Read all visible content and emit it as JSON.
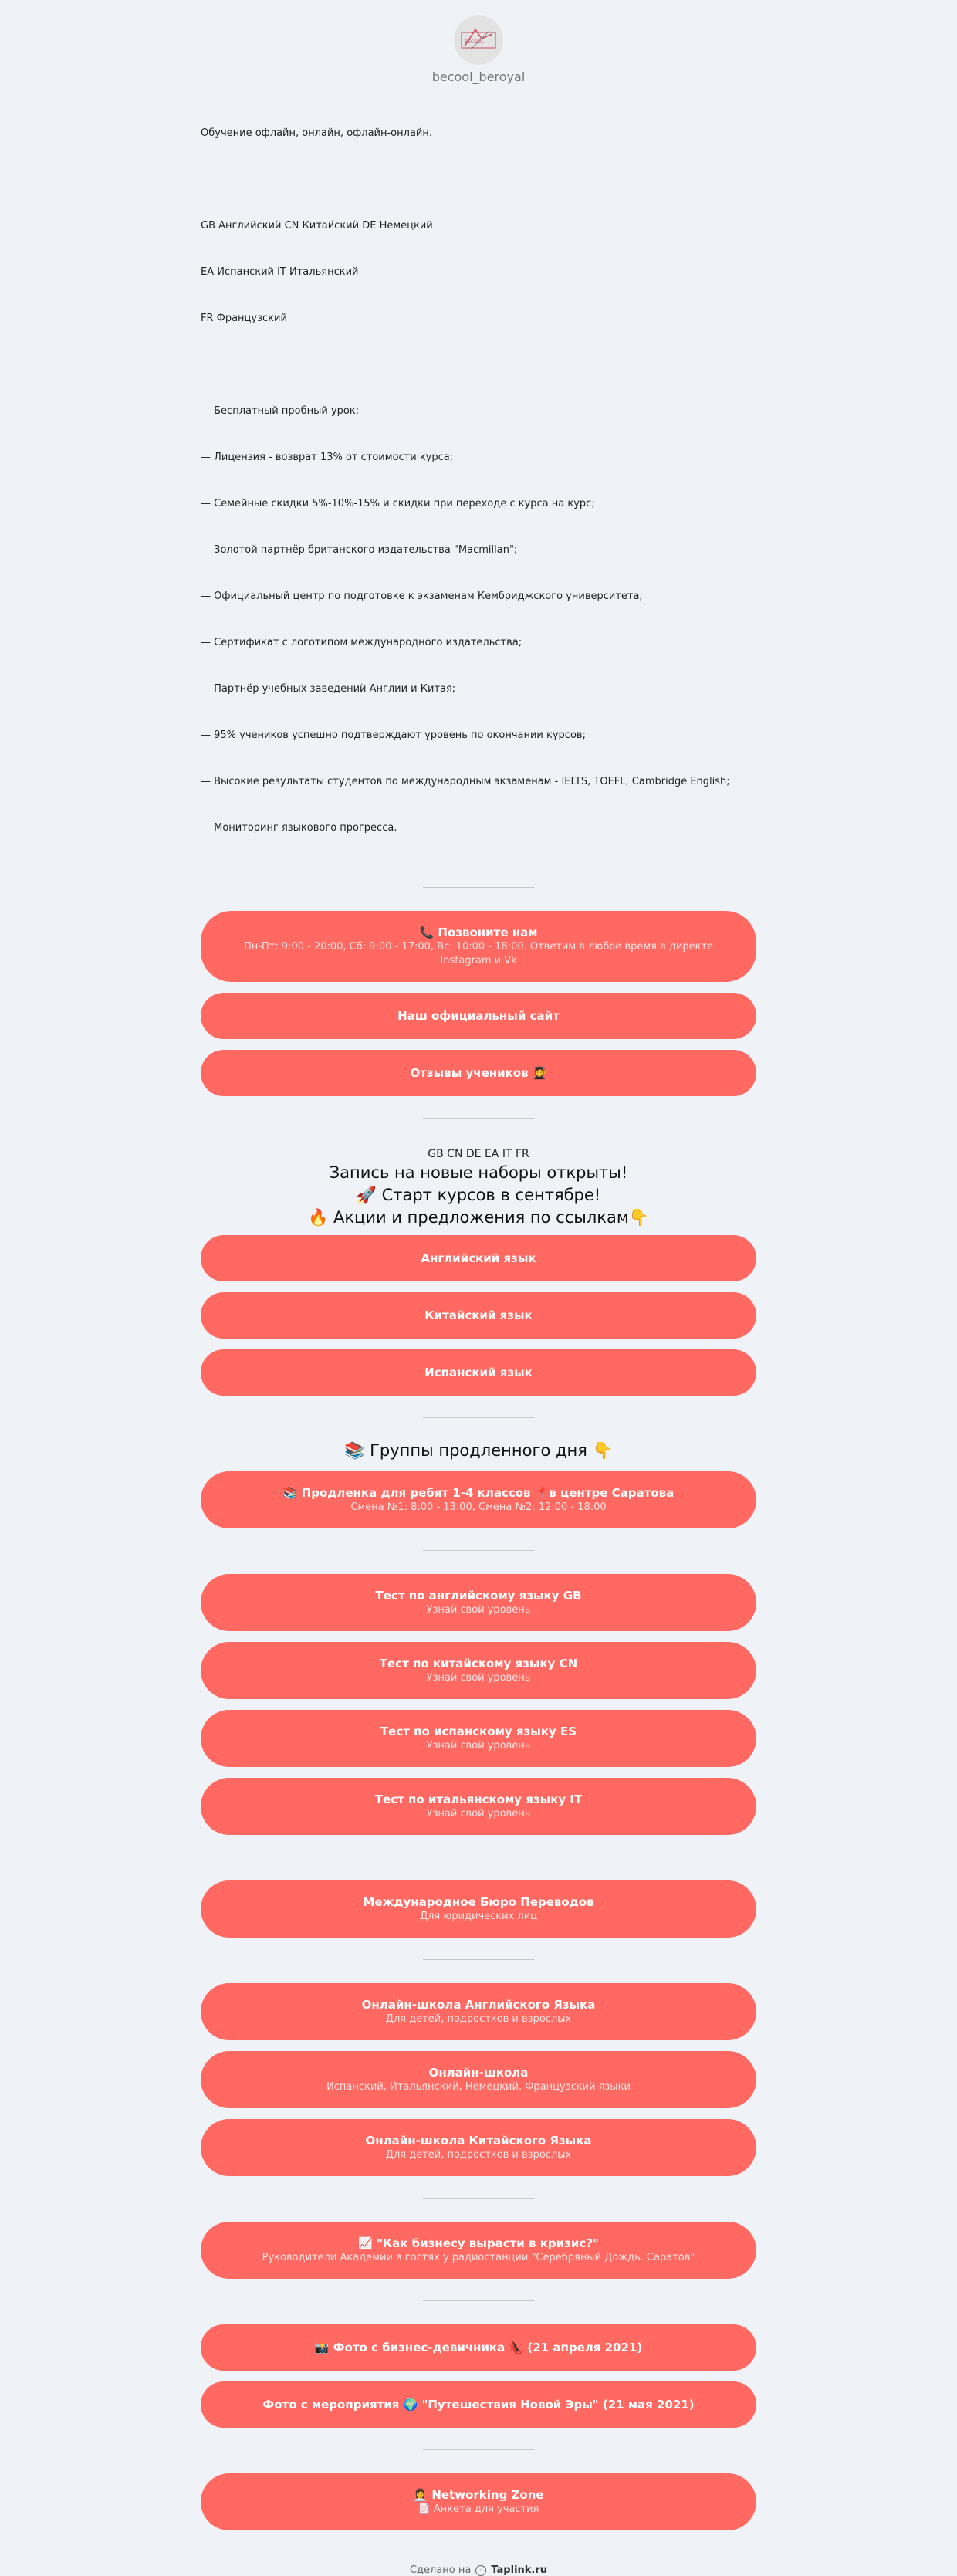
{
  "profile": {
    "username": "becool_beroyal"
  },
  "bio": {
    "line1": "Обучение офлайн, онлайн, офлайн-онлайн.",
    "langs1": "GB Английский CN Китайский DE Немецкий",
    "langs2": "EA Испанский IT Итальянский",
    "langs3": "FR Французский",
    "features": [
      "— Бесплатный пробный урок;",
      "— Лицензия - возврат 13% от стоимости курса;",
      "— Семейные скидки 5%-10%-15% и скидки при переходе с курса на курс;",
      "— Золотой партнёр британского издательства \"Macmillan\";",
      "— Официальный центр по подготовке к экзаменам Кембриджского университета;",
      "— Сертификат с логотипом международного издательства;",
      "— Партнёр учебных заведений Англии и Китая;",
      "— 95% учеников успешно подтверждают уровень по окончании курсов;",
      "— Высокие результаты студентов по международным экзаменам - IELTS, TOEFL, Cambridge English;",
      "— Мониторинг языкового прогресса."
    ]
  },
  "contacts": {
    "call": {
      "title": "📞 Позвоните нам",
      "subtitle": "Пн-Пт: 9:00 - 20:00, Сб: 9:00 - 17:00, Вс: 10:00 - 18:00. Ответим в любое время в директе Instagram и Vk"
    },
    "site": {
      "title": "Наш официальный сайт"
    },
    "reviews": {
      "title": "Отзывы учеников 👩‍🎓"
    }
  },
  "enrollment": {
    "flags": "GB CN DE EA IT FR",
    "line1": "Запись на новые наборы открыты!",
    "line2": "🚀 Старт курсов в сентябре!",
    "line3": "🔥 Акции и предложения по ссылкам👇",
    "buttons": [
      "Английский язык",
      "Китайский язык",
      "Испанский язык"
    ]
  },
  "groups": {
    "heading": "📚 Группы продленного дня 👇",
    "button": {
      "title": "📚 Продленка для ребят 1-4 классов 📍в центре Саратова",
      "subtitle": "Смена №1: 8:00 - 13:00, Смена №2: 12:00 - 18:00"
    }
  },
  "tests": [
    {
      "title": "Тест по английскому языку GB",
      "subtitle": "Узнай свой уровень"
    },
    {
      "title": "Тест по китайскому языку CN",
      "subtitle": "Узнай свой уровень"
    },
    {
      "title": "Тест по испанскому языку ES",
      "subtitle": "Узнай свой уровень"
    },
    {
      "title": "Тест по итальянскому языку IT",
      "subtitle": "Узнай свой уровень"
    }
  ],
  "translation": {
    "title": "Международное Бюро Переводов",
    "subtitle": "Для юридических лиц"
  },
  "online": [
    {
      "title": "Онлайн-школа Английского Языка",
      "subtitle": "Для детей, подростков и взрослых"
    },
    {
      "title": "Онлайн-школа",
      "subtitle": "Испанский, Итальянский, Немецкий, Французский языки"
    },
    {
      "title": "Онлайн-школа Китайского Языка",
      "subtitle": "Для детей, подростков и взрослых"
    }
  ],
  "radio": {
    "title": "📈 \"Как бизнесу вырасти в кризис?\"",
    "subtitle": "Руководители Академии в гостях у радиостанции \"Серебряный Дождь. Саратов\""
  },
  "photos": [
    {
      "title": "📸 Фото с бизнес-девичника 👠 (21 апреля 2021)"
    },
    {
      "title": "Фото с мероприятия 🌍 \"Путешествия Новой Эры\" (21 мая 2021)"
    }
  ],
  "networking": {
    "title": "👩‍💼 Networking Zone",
    "subtitle": "📄 Анкета для участия"
  },
  "footer": {
    "prefix": "Сделано на",
    "brand": "Taplink.ru"
  },
  "colors": {
    "button": "#ff6961",
    "background": "#eff2f7"
  }
}
